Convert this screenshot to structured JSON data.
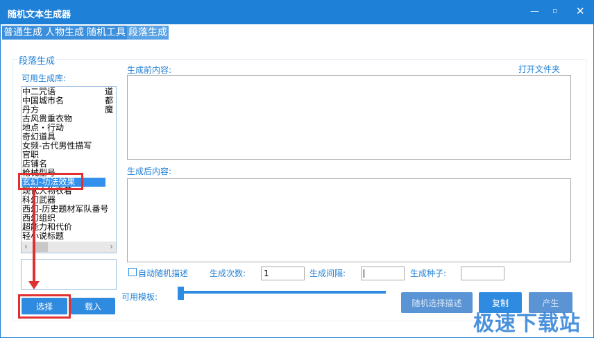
{
  "window": {
    "title": "随机文本生成器",
    "minimize_icon": "minimize-icon",
    "maximize_icon": "maximize-icon",
    "close_icon": "close-icon"
  },
  "tabs": [
    {
      "label": "普通生成"
    },
    {
      "label": "人物生成"
    },
    {
      "label": "随机工具"
    },
    {
      "label": "段落生成",
      "active": true
    }
  ],
  "group": {
    "title": "段落生成"
  },
  "library": {
    "label": "可用生成库:",
    "items": [
      "中二咒语",
      "中国城市名",
      "丹方",
      "古风贵重衣物",
      "地点・行动",
      "奇幻道具",
      "女频-古代男性描写",
      "官职",
      "店铺名",
      "枪械型号",
      "玄幻-功法效果",
      "现代人物衣着",
      "科幻武器",
      "西幻-历史题材军队番号",
      "西幻组织",
      "超能力和代价",
      "轻小说标题"
    ],
    "second_column": [
      "道",
      "都",
      "魔"
    ],
    "selected": "玄幻-功法效果"
  },
  "buttons": {
    "select": "选择",
    "load": "载入",
    "random_desc": "随机选择描述",
    "copy": "复制",
    "generate": "产生"
  },
  "before": {
    "label": "生成前内容:",
    "open_folder": "打开文件夹"
  },
  "after": {
    "label": "生成后内容:"
  },
  "options": {
    "auto_random": "自动随机描述",
    "auto_random_checked": false,
    "count_label": "生成次数:",
    "count_value": "1",
    "interval_label": "生成间隔:",
    "interval_value": "",
    "seed_label": "生成种子:",
    "seed_value": ""
  },
  "template": {
    "label": "可用模板:",
    "slider_value": 0
  },
  "watermark": "极速下载站",
  "colors": {
    "accent": "#1f80d8",
    "annotation": "#e03030"
  }
}
